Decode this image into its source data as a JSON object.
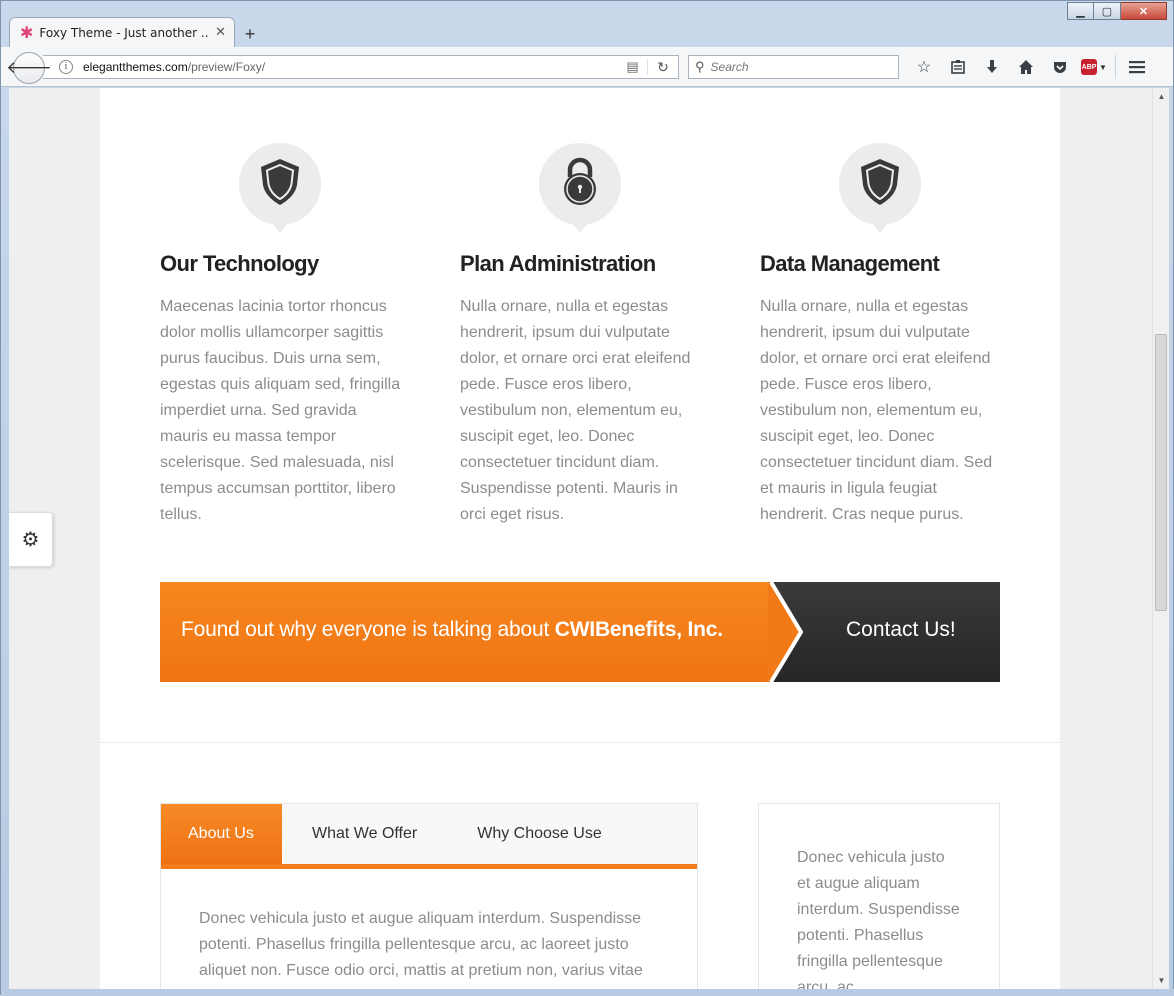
{
  "browser": {
    "tab_title": "Foxy Theme - Just another ...",
    "url_host": "elegantthemes.com",
    "url_path": "/preview/Foxy/",
    "search_placeholder": "Search",
    "abp_label": "ABP"
  },
  "features": [
    {
      "icon": "shield-icon",
      "title": "Our Technology",
      "text": "Maecenas lacinia tortor rhoncus dolor mollis ullamcorper sagittis purus faucibus. Duis urna sem, egestas quis aliquam sed, fringilla imperdiet urna. Sed gravida mauris eu massa tempor scelerisque. Sed malesuada, nisl tempus accumsan porttitor, libero tellus."
    },
    {
      "icon": "lock-icon",
      "title": "Plan Administration",
      "text": "Nulla ornare, nulla et egestas hendrerit, ipsum dui vulputate dolor, et ornare orci erat eleifend pede. Fusce eros libero, vestibulum non, elementum eu, suscipit eget, leo. Donec consectetuer tincidunt diam. Suspendisse potenti. Mauris in orci eget risus."
    },
    {
      "icon": "shield-icon",
      "title": "Data Management",
      "text": "Nulla ornare, nulla et egestas hendrerit, ipsum dui vulputate dolor, et ornare orci erat eleifend pede. Fusce eros libero, vestibulum non, elementum eu, suscipit eget, leo. Donec consectetuer tincidunt diam. Sed et mauris in ligula feugiat hendrerit. Cras neque purus."
    }
  ],
  "cta": {
    "text_prefix": "Found out why everyone is talking about ",
    "text_bold": "CWIBenefits, Inc.",
    "button_label": "Contact Us!"
  },
  "tabs": {
    "items": [
      "About Us",
      "What We Offer",
      "Why Choose Use"
    ],
    "active_index": 0,
    "body": "Donec vehicula justo et augue aliquam interdum. Suspendisse potenti. Phasellus fringilla pellentesque arcu, ac laoreet justo aliquet non. Fusce odio orci, mattis at pretium non, varius vitae"
  },
  "side_box": {
    "text": "Donec vehicula justo et augue aliquam interdum. Suspendisse potenti. Phasellus fringilla pellentesque arcu, ac"
  },
  "colors": {
    "accent": "#f47c1a",
    "dark": "#2e2e2e",
    "body_text": "#8c8c8c"
  }
}
